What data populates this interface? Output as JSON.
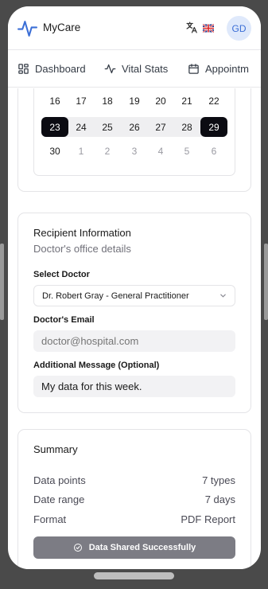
{
  "app": {
    "name": "MyCare",
    "avatar_initials": "GD",
    "flag": "🇬🇧"
  },
  "nav": [
    {
      "label": "Dashboard",
      "icon": "dashboard-icon"
    },
    {
      "label": "Vital Stats",
      "icon": "activity-icon"
    },
    {
      "label": "Appointm",
      "icon": "calendar-icon"
    }
  ],
  "calendar": {
    "rows": [
      [
        "16",
        "17",
        "18",
        "19",
        "20",
        "21",
        "22"
      ],
      [
        "23",
        "24",
        "25",
        "26",
        "27",
        "28",
        "29"
      ],
      [
        "30",
        "1",
        "2",
        "3",
        "4",
        "5",
        "6"
      ]
    ],
    "range_start": "23",
    "range_end": "29"
  },
  "recipient": {
    "title": "Recipient Information",
    "subtitle": "Doctor's office details",
    "select_label": "Select Doctor",
    "selected_doctor": "Dr. Robert Gray - General Practitioner",
    "email_label": "Doctor's Email",
    "email_placeholder": "doctor@hospital.com",
    "message_label": "Additional Message (Optional)",
    "message_value": "My data for this week."
  },
  "summary": {
    "title": "Summary",
    "rows": [
      {
        "label": "Data points",
        "value": "7 types"
      },
      {
        "label": "Date range",
        "value": "7 days"
      },
      {
        "label": "Format",
        "value": "PDF Report"
      }
    ],
    "button_label": "Data Shared Successfully"
  },
  "colors": {
    "accent": "#3c6fd6",
    "selected_day": "#0b0b12",
    "button_disabled": "#7c7c84"
  }
}
